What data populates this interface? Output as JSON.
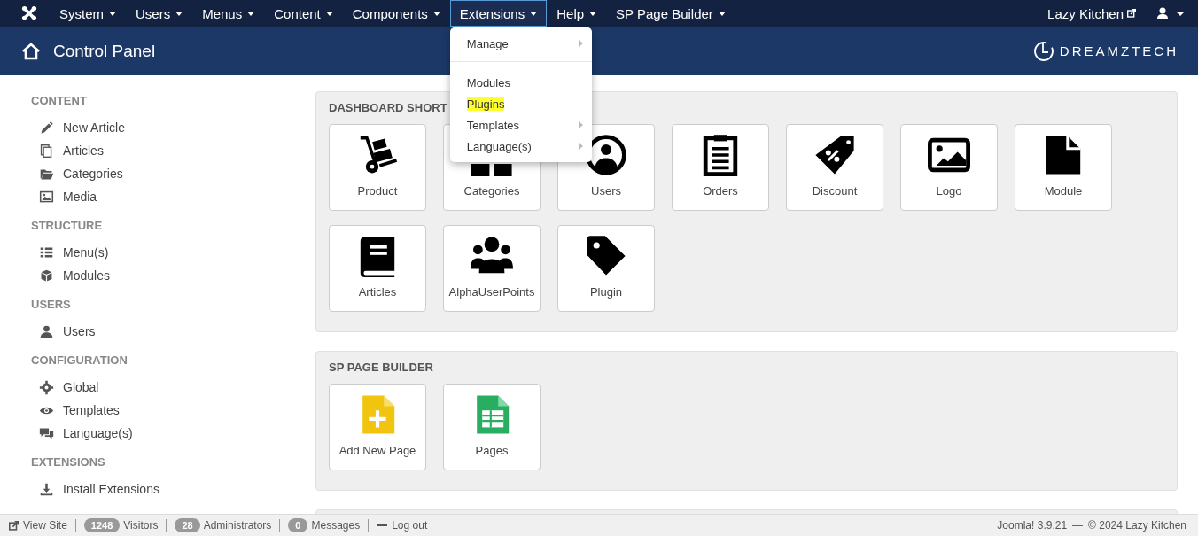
{
  "nav": {
    "items": [
      {
        "label": "System",
        "selected": false
      },
      {
        "label": "Users",
        "selected": false
      },
      {
        "label": "Menus",
        "selected": false
      },
      {
        "label": "Content",
        "selected": false
      },
      {
        "label": "Components",
        "selected": false
      },
      {
        "label": "Extensions",
        "selected": true,
        "dropdown": {
          "groups": [
            [
              {
                "label": "Manage",
                "submenu": true,
                "highlighted": false
              }
            ],
            [
              {
                "label": "Modules",
                "submenu": false,
                "highlighted": false
              },
              {
                "label": "Plugins",
                "submenu": false,
                "highlighted": true
              },
              {
                "label": "Templates",
                "submenu": true,
                "highlighted": false
              },
              {
                "label": "Language(s)",
                "submenu": true,
                "highlighted": false
              }
            ]
          ]
        }
      },
      {
        "label": "Help",
        "selected": false
      },
      {
        "label": "SP Page Builder",
        "selected": false
      }
    ],
    "site_link": "Lazy Kitchen"
  },
  "header": {
    "title": "Control Panel",
    "brand": "DREAMZTECH"
  },
  "sidebar": {
    "sections": [
      {
        "title": "CONTENT",
        "items": [
          "New Article",
          "Articles",
          "Categories",
          "Media"
        ]
      },
      {
        "title": "STRUCTURE",
        "items": [
          "Menu(s)",
          "Modules"
        ]
      },
      {
        "title": "USERS",
        "items": [
          "Users"
        ]
      },
      {
        "title": "CONFIGURATION",
        "items": [
          "Global",
          "Templates",
          "Language(s)"
        ]
      },
      {
        "title": "EXTENSIONS",
        "items": [
          "Install Extensions"
        ]
      }
    ]
  },
  "panels": [
    {
      "title": "DASHBOARD SHORT",
      "tiles": [
        "Product",
        "Categories",
        "Users",
        "Orders",
        "Discount",
        "Logo",
        "Module",
        "Articles",
        "AlphaUserPoints",
        "Plugin"
      ]
    },
    {
      "title": "SP PAGE BUILDER",
      "tiles": [
        "Add New Page",
        "Pages"
      ]
    }
  ],
  "status_bar": {
    "view_site": "View Site",
    "counters": [
      {
        "count": "1248",
        "label": "Visitors"
      },
      {
        "count": "28",
        "label": "Administrators"
      },
      {
        "count": "0",
        "label": "Messages"
      }
    ],
    "logout": "Log out",
    "version": "Joomla! 3.9.21",
    "separator": "—",
    "copyright": "© 2024 Lazy Kitchen"
  }
}
